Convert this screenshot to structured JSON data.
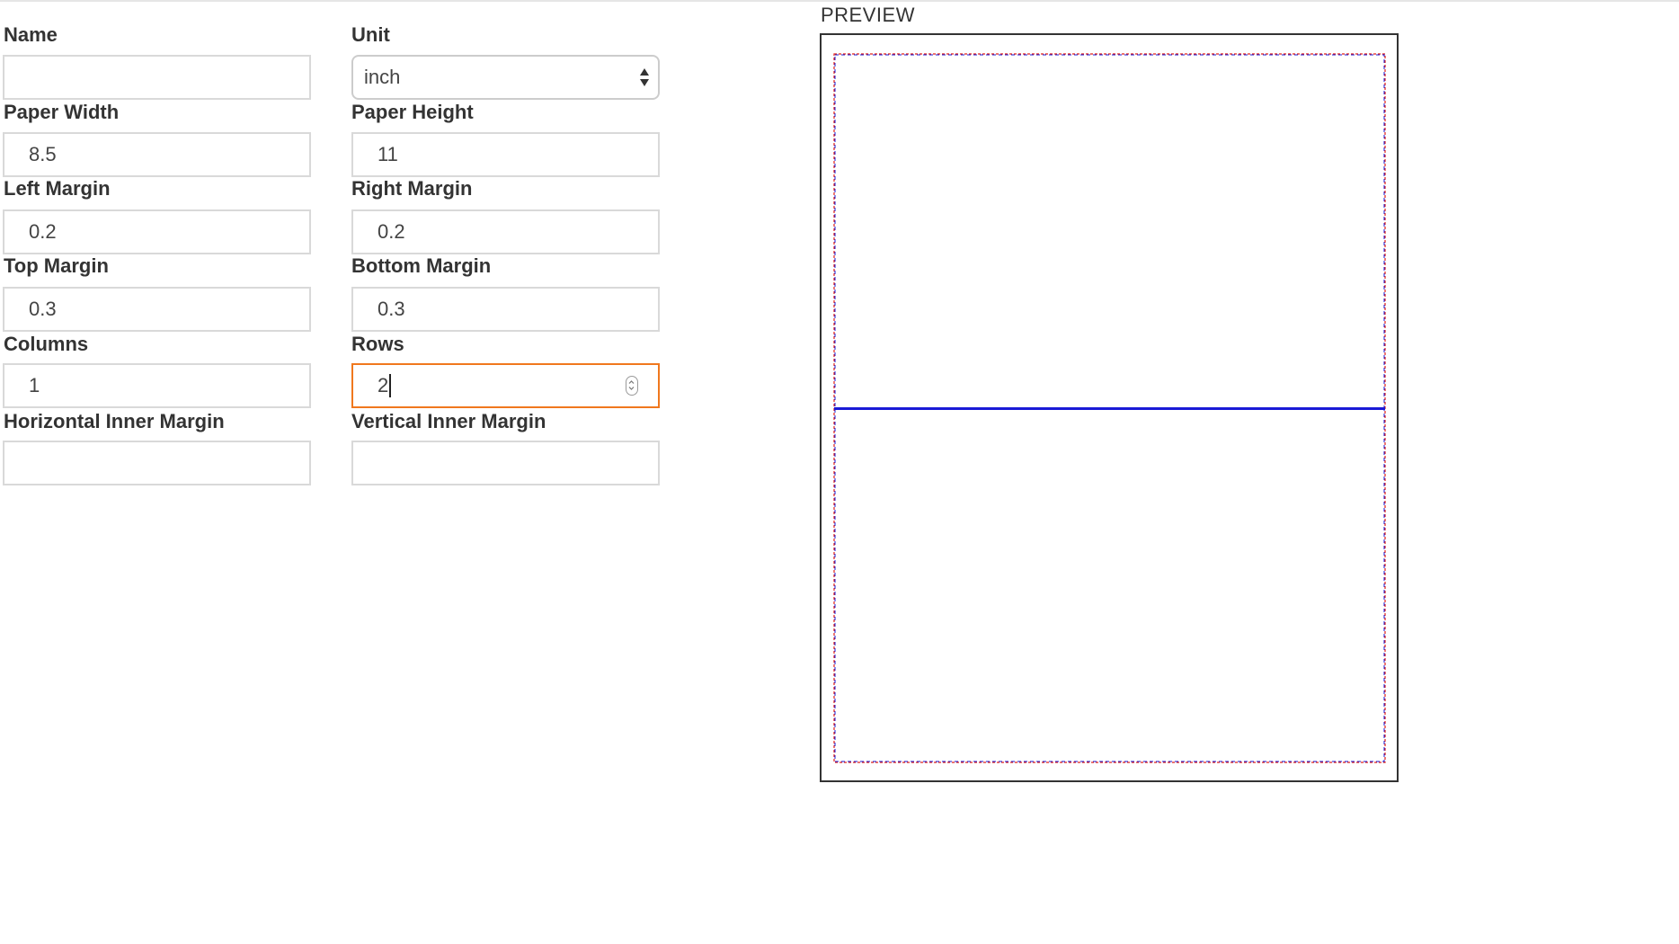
{
  "form": {
    "name": {
      "label": "Name",
      "value": ""
    },
    "unit": {
      "label": "Unit",
      "value": "inch"
    },
    "paper_width": {
      "label": "Paper Width",
      "value": "8.5"
    },
    "paper_height": {
      "label": "Paper Height",
      "value": "11"
    },
    "left_margin": {
      "label": "Left Margin",
      "value": "0.2"
    },
    "right_margin": {
      "label": "Right Margin",
      "value": "0.2"
    },
    "top_margin": {
      "label": "Top Margin",
      "value": "0.3"
    },
    "bottom_margin": {
      "label": "Bottom Margin",
      "value": "0.3"
    },
    "columns": {
      "label": "Columns",
      "value": "1"
    },
    "rows": {
      "label": "Rows",
      "value": "2"
    },
    "horizontal_inner_margin": {
      "label": "Horizontal Inner Margin",
      "value": ""
    },
    "vertical_inner_margin": {
      "label": "Vertical Inner Margin",
      "value": ""
    }
  },
  "preview": {
    "title": "PREVIEW",
    "colors": {
      "frame": "#333333",
      "margin_guide": "#e0201c",
      "cell_border": "#1a1ad6",
      "focus": "#f0781e"
    }
  }
}
